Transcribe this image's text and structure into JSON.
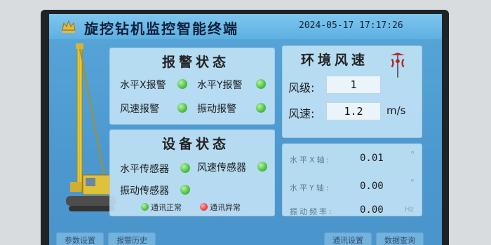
{
  "header": {
    "title": "旋挖钻机监控智能终端",
    "datetime": "2024-05-17 17:17:26",
    "logo_icon": "crown-logo-icon"
  },
  "alarm_panel": {
    "title": "报警状态",
    "items": [
      {
        "label": "水平X报警",
        "status": "green"
      },
      {
        "label": "水平Y报警",
        "status": "green"
      },
      {
        "label": "风速报警",
        "status": "green"
      },
      {
        "label": "振动报警",
        "status": "green"
      }
    ]
  },
  "device_panel": {
    "title": "设备状态",
    "items": [
      {
        "label": "水平传感器",
        "status": "green"
      },
      {
        "label": "风速传感器",
        "status": "green"
      },
      {
        "label": "振动传感器",
        "status": "green"
      }
    ],
    "legend": [
      {
        "label": "通讯正常",
        "color": "#55c448"
      },
      {
        "label": "通讯异常",
        "color": "#ee4b4b"
      }
    ]
  },
  "wind_panel": {
    "title": "环境风速",
    "icon": "wind-vane-icon",
    "level_label": "风级:",
    "level_value": "1",
    "speed_label": "风速:",
    "speed_value": "1.2",
    "speed_unit": "m/s"
  },
  "sensor_panel": {
    "rows": [
      {
        "label": "水平X轴:",
        "value": "0.01",
        "unit": "°"
      },
      {
        "label": "水平Y轴:",
        "value": "0.00",
        "unit": "°"
      },
      {
        "label": "振动频率:",
        "value": "0.00",
        "unit": "Hz"
      }
    ]
  },
  "footer": {
    "buttons": [
      "参数设置",
      "报警历史",
      "通讯设置",
      "数据查询"
    ]
  },
  "colors": {
    "status_ok": "#55c448",
    "status_error": "#ee4b4b",
    "screen_bg": "#4c99cf"
  }
}
